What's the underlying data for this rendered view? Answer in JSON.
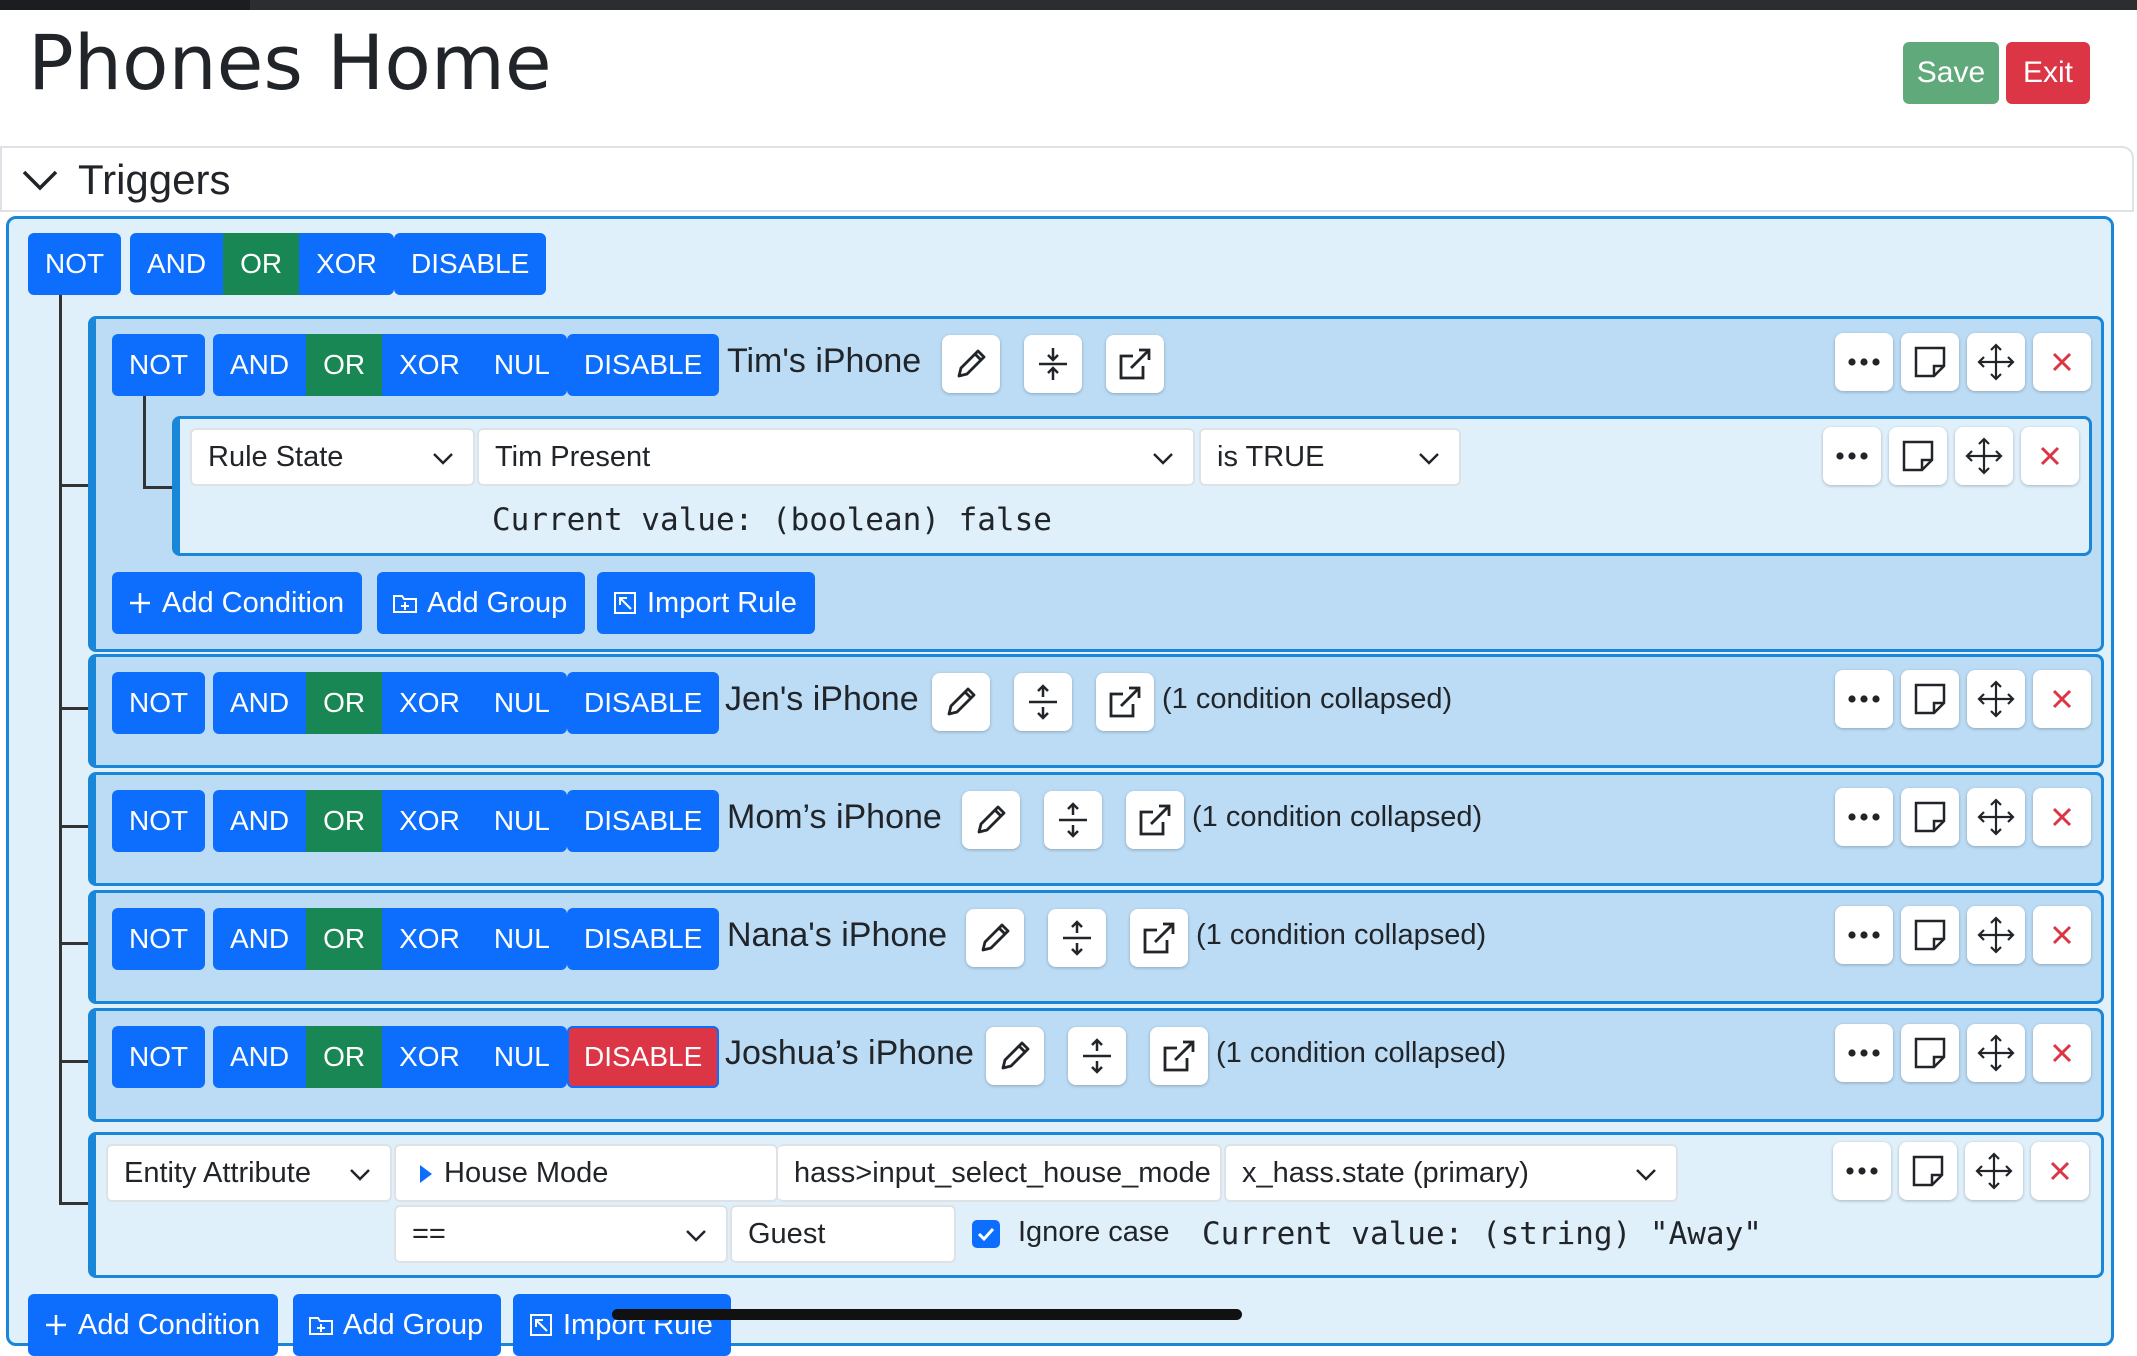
{
  "page": {
    "title": "Phones Home",
    "save_label": "Save",
    "exit_label": "Exit"
  },
  "triggers": {
    "title": "Triggers"
  },
  "root_ops": {
    "not": "NOT",
    "and": "AND",
    "or": "OR",
    "xor": "XOR",
    "disable": "DISABLE"
  },
  "ops": {
    "not": "NOT",
    "and": "AND",
    "or": "OR",
    "xor": "XOR",
    "nul": "NUL",
    "disable": "DISABLE"
  },
  "groups": [
    {
      "name": "Tim's iPhone"
    },
    {
      "name": "Jen's iPhone",
      "collapsed": "(1 condition collapsed)"
    },
    {
      "name": "Mom’s iPhone",
      "collapsed": "(1 condition collapsed)"
    },
    {
      "name": "Nana's iPhone",
      "collapsed": "(1 condition collapsed)"
    },
    {
      "name": "Joshua’s iPhone",
      "collapsed": "(1 condition collapsed)"
    }
  ],
  "tim_condition": {
    "type": "Rule State",
    "rule": "Tim Present",
    "test": "is TRUE",
    "current": "Current value: (boolean) false"
  },
  "entity_condition": {
    "type": "Entity Attribute",
    "entity": "House Mode",
    "entity_id": "hass>input_select_house_mode",
    "attribute": "x_hass.state (primary)",
    "operator": "==",
    "value": "Guest",
    "ignore_case": "Ignore case",
    "current": "Current value: (string) \"Away\""
  },
  "actions": {
    "add_condition": "Add Condition",
    "add_group": "Add Group",
    "import_rule": "Import Rule"
  },
  "colors": {
    "primary": "#0d6efd",
    "selected": "#198754",
    "danger": "#dc3545",
    "save": "#5fa97a"
  }
}
